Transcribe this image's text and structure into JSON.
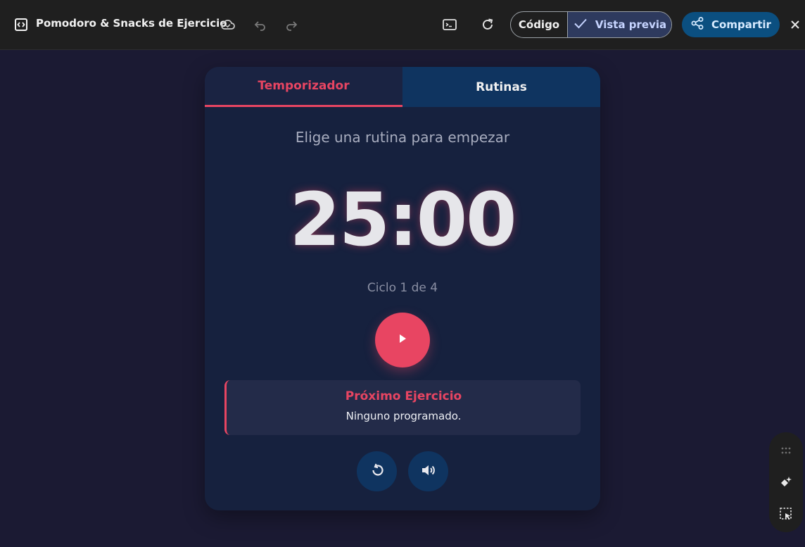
{
  "app": {
    "title": "Pomodoro & Snacks de Ejercicio"
  },
  "toolbar": {
    "code_label": "Código",
    "preview_label": "Vista previa",
    "share_label": "Compartir"
  },
  "tabs": [
    {
      "label": "Temporizador",
      "active": true
    },
    {
      "label": "Rutinas",
      "active": false
    }
  ],
  "timer": {
    "subtitle": "Elige una rutina para empezar",
    "time": "25:00",
    "cycle": "Ciclo 1 de 4"
  },
  "next_exercise": {
    "title": "Próximo Ejercicio",
    "text": "Ninguno programado."
  },
  "icons": {
    "app": "code-frame-icon",
    "cloud": "cloud-icon",
    "undo": "undo-icon",
    "redo": "redo-icon",
    "terminal": "terminal-icon",
    "refresh": "refresh-icon",
    "check": "check-icon",
    "share": "share-icon",
    "close": "close-icon",
    "play": "play-icon",
    "reset": "reset-icon",
    "volume": "volume-icon",
    "drag": "drag-handle-icon",
    "sparkle": "sparkle-edit-icon",
    "select": "select-element-icon"
  },
  "colors": {
    "accent": "#e84562",
    "card": "#16213e",
    "tab_inactive": "#0f3460",
    "background": "#1b1a33",
    "share": "#0b4f80"
  }
}
